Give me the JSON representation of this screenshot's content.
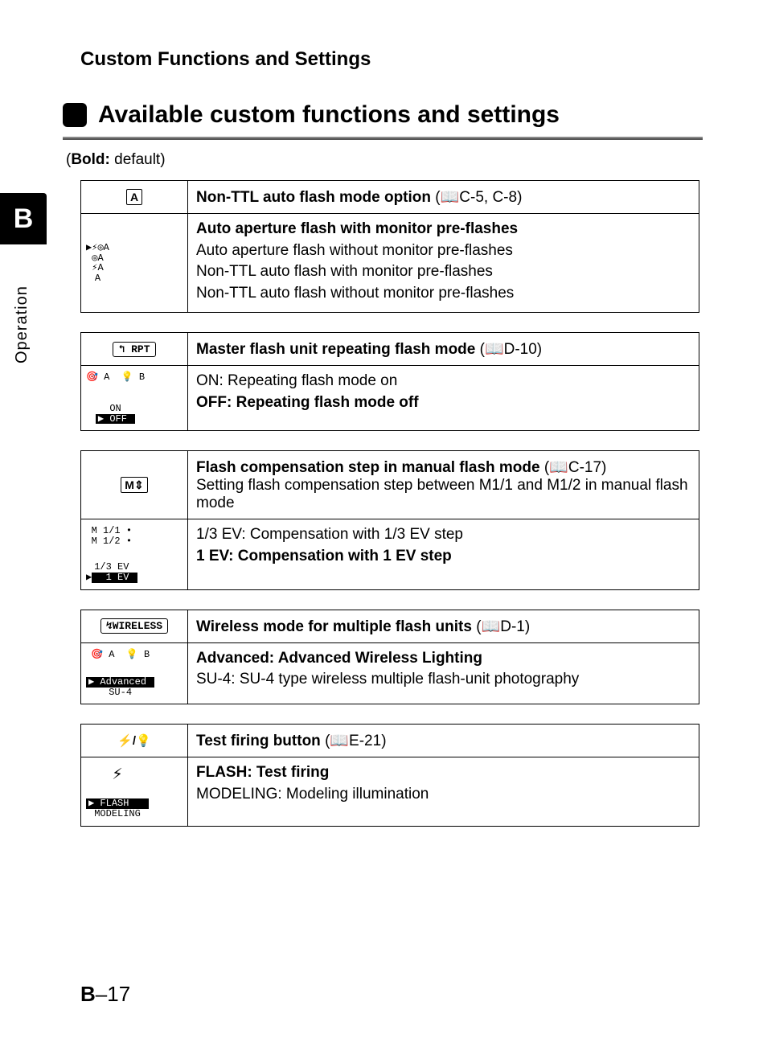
{
  "breadcrumb": "Custom Functions and Settings",
  "title": "Available custom functions and settings",
  "default_note_prefix": "(",
  "default_note_bold": "Bold:",
  "default_note_rest": " default)",
  "sidebar": {
    "letter": "B",
    "word": "Operation"
  },
  "page_number_prefix": "B",
  "page_number_suffix": "–17",
  "book_icon": "📖",
  "settings": [
    {
      "heading_bold": "Non-TTL auto flash mode option",
      "heading_ref": " (📖C-5, C-8)",
      "heading_sub": "",
      "lines": [
        {
          "bold": true,
          "text": "Auto aperture flash with monitor pre-flashes"
        },
        {
          "bold": false,
          "text": "Auto aperture flash without monitor pre-flashes"
        },
        {
          "bold": false,
          "text": "Non-TTL auto flash with monitor pre-flashes"
        },
        {
          "bold": false,
          "text": "Non-TTL auto flash without monitor pre-flashes"
        }
      ]
    },
    {
      "heading_bold": "Master flash unit repeating flash mode",
      "heading_ref": " (📖D-10)",
      "heading_sub": "",
      "lines": [
        {
          "bold": false,
          "text": "ON: Repeating flash mode on"
        },
        {
          "bold": true,
          "text": "OFF: Repeating flash mode off"
        }
      ]
    },
    {
      "heading_bold": "Flash compensation step in manual flash mode",
      "heading_ref": " (📖C-17)",
      "heading_sub": "Setting flash compensation step between M1/1 and M1/2 in manual flash mode",
      "lines": [
        {
          "bold": false,
          "text": "1/3 EV: Compensation with 1/3 EV step"
        },
        {
          "bold": true,
          "text": "1 EV: Compensation with 1 EV step"
        }
      ]
    },
    {
      "heading_bold": "Wireless mode for multiple flash units",
      "heading_ref": " (📖D-1)",
      "heading_sub": "",
      "lines": [
        {
          "bold": true,
          "text": "Advanced: Advanced Wireless Lighting"
        },
        {
          "bold": false,
          "text": "SU-4: SU-4 type wireless multiple flash-unit photography"
        }
      ]
    },
    {
      "heading_bold": "Test firing button",
      "heading_ref": " (📖E-21)",
      "heading_sub": "",
      "lines": [
        {
          "bold": true,
          "text": "FLASH: Test firing"
        },
        {
          "bold": false,
          "text": "MODELING: Modeling illumination"
        }
      ]
    }
  ],
  "lcd_icons": {
    "0_header": "A",
    "0_body": "▶⚡◎A\n◎A\n⚡A\nA",
    "1_header": "↰ RPT",
    "1_body_top": "🎯 A  💡 B",
    "1_body_bot": "ON\n▶ OFF ",
    "2_header": "M⇕",
    "2_body_top": "M 1/1 •\nM 1/2 •",
    "2_body_bot": "1/3 EV\n▶  1 EV ",
    "3_header": "↯WIRELESS",
    "3_body_top": "🎯 A  💡 B",
    "3_body_bot": "▶ Advanced \nSU-4",
    "4_header": "⚡/💡",
    "4_body_top": "⚡",
    "4_body_bot": "▶ FLASH   \nMODELING"
  }
}
